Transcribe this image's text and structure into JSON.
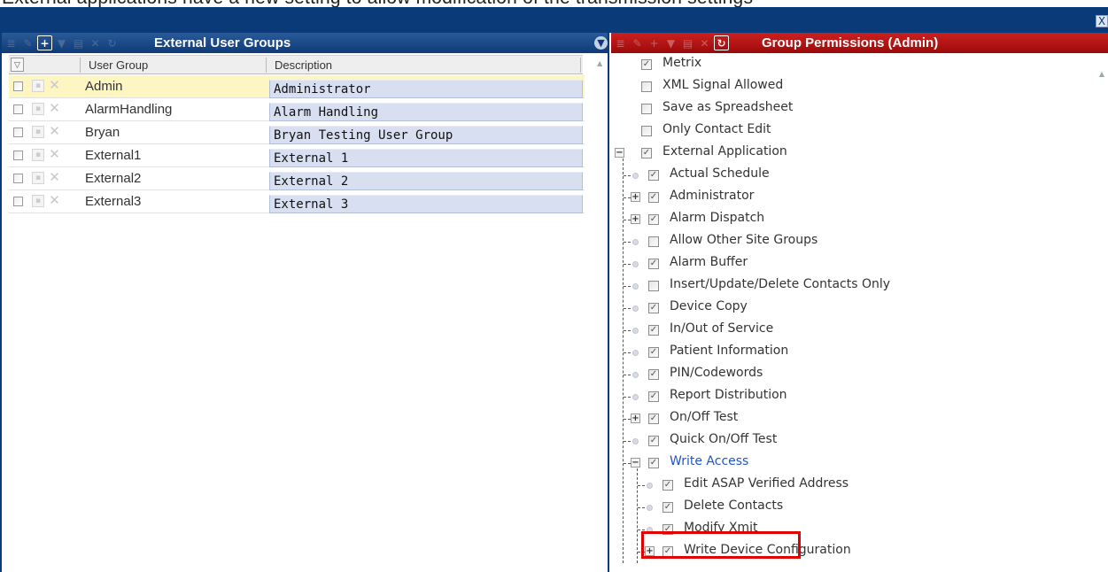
{
  "caption": {
    "text": "External applications have a new setting to allow modification of the transmission settings"
  },
  "window": {
    "close_glyph": "X"
  },
  "left_panel": {
    "title": "External User Groups",
    "collapse_glyph": "▼",
    "columns": {
      "user_group": "User Group",
      "description": "Description"
    },
    "rows": [
      {
        "user_group": "Admin",
        "description": "Administrator",
        "selected": true
      },
      {
        "user_group": "AlarmHandling",
        "description": "Alarm Handling",
        "selected": false
      },
      {
        "user_group": "Bryan",
        "description": "Bryan  Testing User Group",
        "selected": false
      },
      {
        "user_group": "External1",
        "description": "External 1",
        "selected": false
      },
      {
        "user_group": "External2",
        "description": "External 2",
        "selected": false
      },
      {
        "user_group": "External3",
        "description": "External 3",
        "selected": false
      }
    ]
  },
  "right_panel": {
    "title": "Group Permissions (Admin)",
    "tree": [
      {
        "label": "Metrix",
        "checked": true,
        "level": 0,
        "kind": "leaf-top"
      },
      {
        "label": "XML Signal Allowed",
        "checked": false,
        "level": 0,
        "kind": "leaf-top"
      },
      {
        "label": "Save as Spreadsheet",
        "checked": false,
        "level": 0,
        "kind": "leaf-top"
      },
      {
        "label": "Only Contact Edit",
        "checked": false,
        "level": 0,
        "kind": "leaf-top"
      },
      {
        "label": "External Application",
        "checked": true,
        "level": 0,
        "kind": "expanded"
      },
      {
        "label": "Actual Schedule",
        "checked": true,
        "level": 1,
        "kind": "leaf"
      },
      {
        "label": "Administrator",
        "checked": true,
        "level": 1,
        "kind": "collapsed"
      },
      {
        "label": "Alarm Dispatch",
        "checked": true,
        "level": 1,
        "kind": "collapsed"
      },
      {
        "label": "Allow Other Site Groups",
        "checked": false,
        "level": 1,
        "kind": "leaf"
      },
      {
        "label": "Alarm Buffer",
        "checked": true,
        "level": 1,
        "kind": "leaf"
      },
      {
        "label": "Insert/Update/Delete Contacts Only",
        "checked": false,
        "level": 1,
        "kind": "leaf"
      },
      {
        "label": "Device Copy",
        "checked": true,
        "level": 1,
        "kind": "leaf"
      },
      {
        "label": "In/Out of Service",
        "checked": true,
        "level": 1,
        "kind": "leaf"
      },
      {
        "label": "Patient Information",
        "checked": true,
        "level": 1,
        "kind": "leaf"
      },
      {
        "label": "PIN/Codewords",
        "checked": true,
        "level": 1,
        "kind": "leaf"
      },
      {
        "label": "Report Distribution",
        "checked": true,
        "level": 1,
        "kind": "leaf"
      },
      {
        "label": "On/Off Test",
        "checked": true,
        "level": 1,
        "kind": "collapsed"
      },
      {
        "label": "Quick On/Off Test",
        "checked": true,
        "level": 1,
        "kind": "leaf"
      },
      {
        "label": "Write Access",
        "checked": true,
        "level": 1,
        "kind": "expanded",
        "link": true
      },
      {
        "label": "Edit ASAP Verified Address",
        "checked": true,
        "level": 2,
        "kind": "leaf"
      },
      {
        "label": "Delete Contacts",
        "checked": true,
        "level": 2,
        "kind": "leaf"
      },
      {
        "label": "Modify Xmit",
        "checked": true,
        "level": 2,
        "kind": "leaf",
        "highlighted": true
      },
      {
        "label": "Write Device Configuration",
        "checked": true,
        "level": 2,
        "kind": "collapsed"
      }
    ]
  },
  "colors": {
    "navy": "#0b3a78",
    "red_header": "#b01010",
    "highlight": "#e00000",
    "selected_row": "#fdf6c3"
  }
}
